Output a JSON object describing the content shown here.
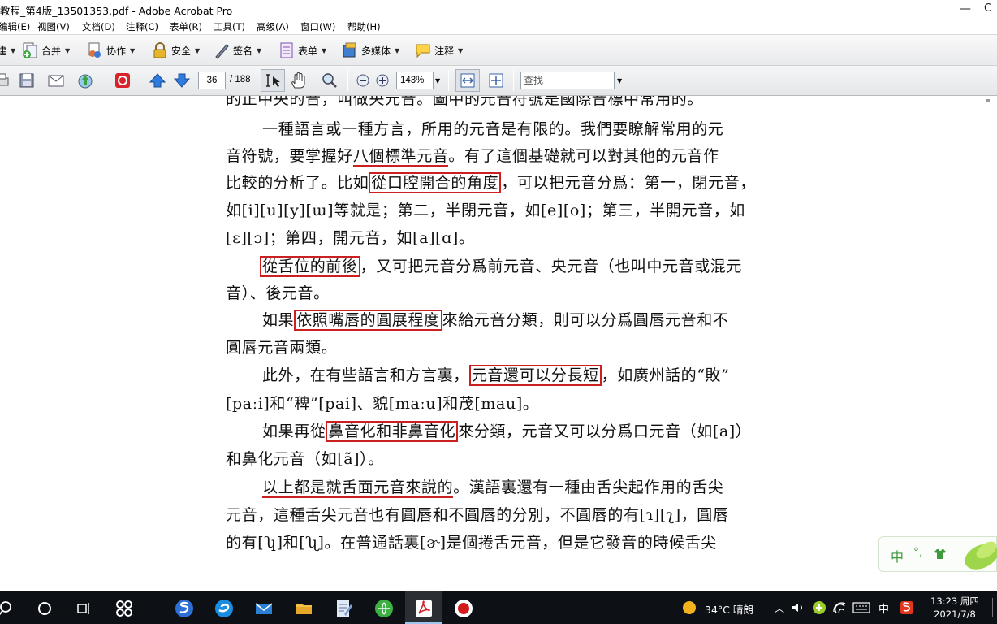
{
  "window": {
    "title": "教程_第4版_13501353.pdf - Adobe Acrobat Pro",
    "minimize_glyph": "—",
    "restore_glyph": "C"
  },
  "menu": [
    "编辑(E)",
    "视图(V)",
    "文档(D)",
    "注释(C)",
    "表单(R)",
    "工具(T)",
    "高级(A)",
    "窗口(W)",
    "帮助(H)"
  ],
  "toolbar1": {
    "create_partial": "建",
    "combine": "合并",
    "collaborate": "协作",
    "secure": "安全",
    "sign": "签名",
    "forms": "表单",
    "multimedia": "多媒体",
    "comment": "注释"
  },
  "toolbar2": {
    "page_current": "36",
    "page_total": "/ 188",
    "zoom": "143%",
    "search_placeholder": "查找"
  },
  "document": {
    "line0": "的正中央的音，叫做央元音。圖中的元音符號是國際音標中常用的。",
    "p1_a": "一種語言或一種方言，所用的元音是有限的。我們要瞭解常用的元",
    "p1_b1": "音符號，要掌握好",
    "p1_b_ul": "八個標準元音",
    "p1_b2": "。有了這個基礎就可以對其他的元音作",
    "p1_c1": "比較的分析了。比如",
    "p1_c_box": "從口腔開合的角度",
    "p1_c2": "，可以把元音分爲：第一，閉元音，",
    "p1_d": "如[i][u][y][ɯ]等就是；第二，半閉元音，如[e][o]；第三，半開元音，如",
    "p1_e": "[ɛ][ɔ]；第四，開元音，如[a][ɑ]。",
    "p2_box": "從舌位的前後",
    "p2_a": "，又可把元音分爲前元音、央元音（也叫中元音或混元",
    "p2_b": "音）、後元音。",
    "p3_a1": "如果",
    "p3_box": "依照嘴唇的圓展程度",
    "p3_a2": "來給元音分類，則可以分爲圓唇元音和不",
    "p3_b": "圓唇元音兩類。",
    "p4_a1": "此外，在有些語言和方言裏，",
    "p4_box": "元音還可以分長短",
    "p4_a2": "，如廣州話的“敗”",
    "p4_b": "[paːi]和“稗”[pai]、貌[maːu]和茂[mau]。",
    "p5_a1": "如果再從",
    "p5_box": "鼻音化和非鼻音化",
    "p5_a2": "來分類，元音又可以分爲口元音（如[a]）",
    "p5_b": "和鼻化元音（如[ã]）。",
    "p6_ul": "以上都是就舌面元音來說的",
    "p6_a2": "。漢語裏還有一種由舌尖起作用的舌尖",
    "p6_b": "元音，這種舌尖元音也有圓唇和不圓唇的分別，不圓唇的有[ɿ][ʅ]，圓唇",
    "p6_c": "的有[ʮ]和[ʯ]。在普通話裏[ɚ]是個捲舌元音，但是它發音的時候舌尖"
  },
  "ime": {
    "lang": "中",
    "punct": "°,"
  },
  "taskbar": {
    "weather": "34°C  晴朗",
    "tray_ime": "中",
    "time": "13:23 周四",
    "date": "2021/7/8"
  },
  "colors": {
    "annotation_red": "#cc1f1f",
    "taskbar_bg": "#0d1015",
    "ime_green": "#3d9a3d"
  }
}
